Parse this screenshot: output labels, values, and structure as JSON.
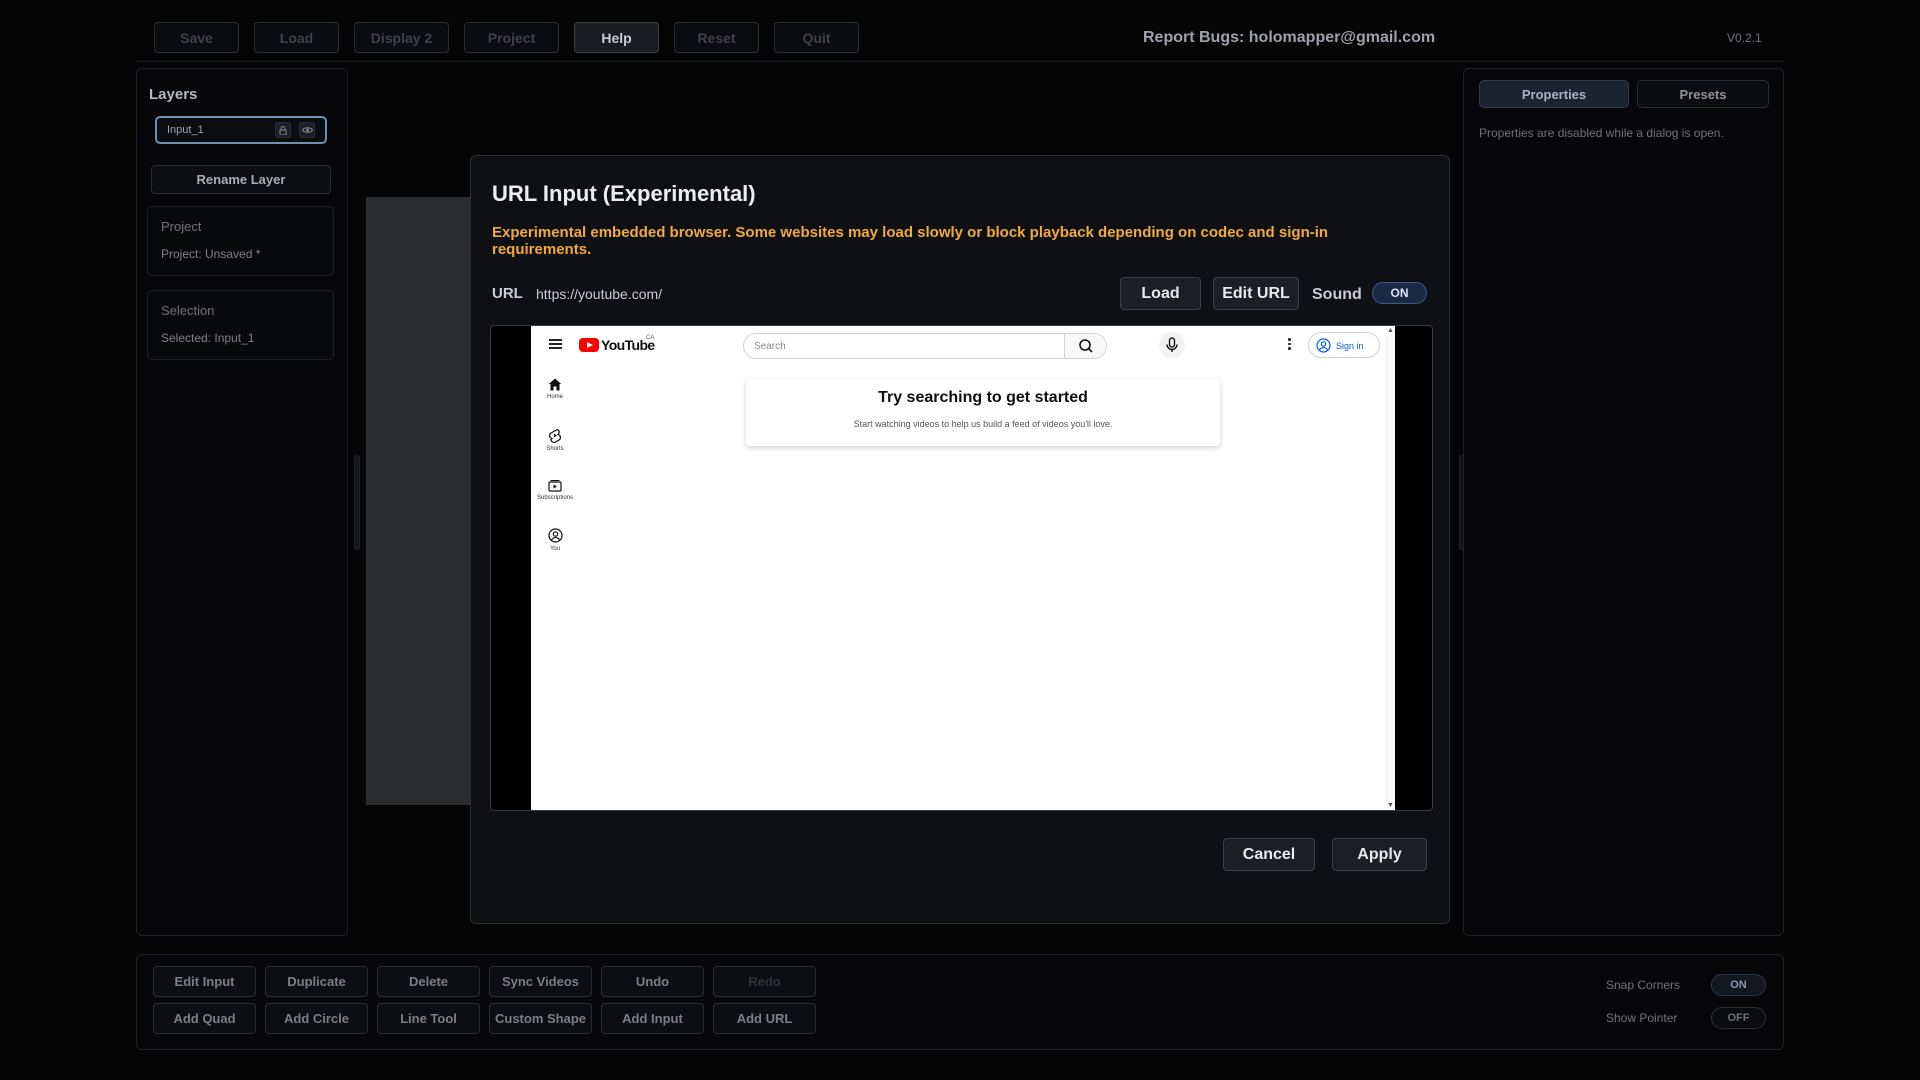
{
  "toolbar": {
    "buttons": [
      "Save",
      "Load",
      "Display 2",
      "Project",
      "Help",
      "Reset",
      "Quit"
    ],
    "report_bugs": "Report Bugs: holomapper@gmail.com",
    "version": "V0.2.1"
  },
  "layers": {
    "title": "Layers",
    "items": [
      {
        "name": "Input_1",
        "selected": true
      }
    ],
    "rename_label": "Rename Layer"
  },
  "project_card": {
    "title": "Project",
    "value": "Project: Unsaved *"
  },
  "selection_card": {
    "title": "Selection",
    "value": "Selected: Input_1"
  },
  "right_panel": {
    "tabs": [
      {
        "label": "Properties",
        "active": true
      },
      {
        "label": "Presets",
        "active": false
      }
    ],
    "note": "Properties are disabled while a dialog is open."
  },
  "bottom": {
    "row1": [
      "Edit Input",
      "Duplicate",
      "Delete",
      "Sync Videos",
      "Undo",
      "Redo"
    ],
    "row2": [
      "Add Quad",
      "Add Circle",
      "Line Tool",
      "Custom Shape",
      "Add Input",
      "Add URL"
    ],
    "options": [
      {
        "label": "Snap Corners",
        "value": "ON"
      },
      {
        "label": "Show Pointer",
        "value": "OFF"
      }
    ]
  },
  "dialog": {
    "title": "URL Input (Experimental)",
    "warning": "Experimental embedded browser. Some websites may load slowly or block playback depending on codec and sign-in requirements.",
    "url_label": "URL",
    "url_value": "https://youtube.com/",
    "load_label": "Load",
    "edit_url_label": "Edit URL",
    "sound_label": "Sound",
    "sound_value": "ON",
    "cancel_label": "Cancel",
    "apply_label": "Apply"
  },
  "youtube": {
    "logo_text": "YouTube",
    "country": "CA",
    "search_placeholder": "Search",
    "signin": "Sign in",
    "nav": [
      "Home",
      "Shorts",
      "Subscriptions",
      "You"
    ],
    "card_title": "Try searching to get started",
    "card_subtitle": "Start watching videos to help us build a feed of videos you'll love."
  },
  "colors": {
    "accent_warning": "#f2a93b",
    "toggle_on": "#1a2a45",
    "youtube_red": "#ff0000",
    "signin_blue": "#065fd4"
  }
}
